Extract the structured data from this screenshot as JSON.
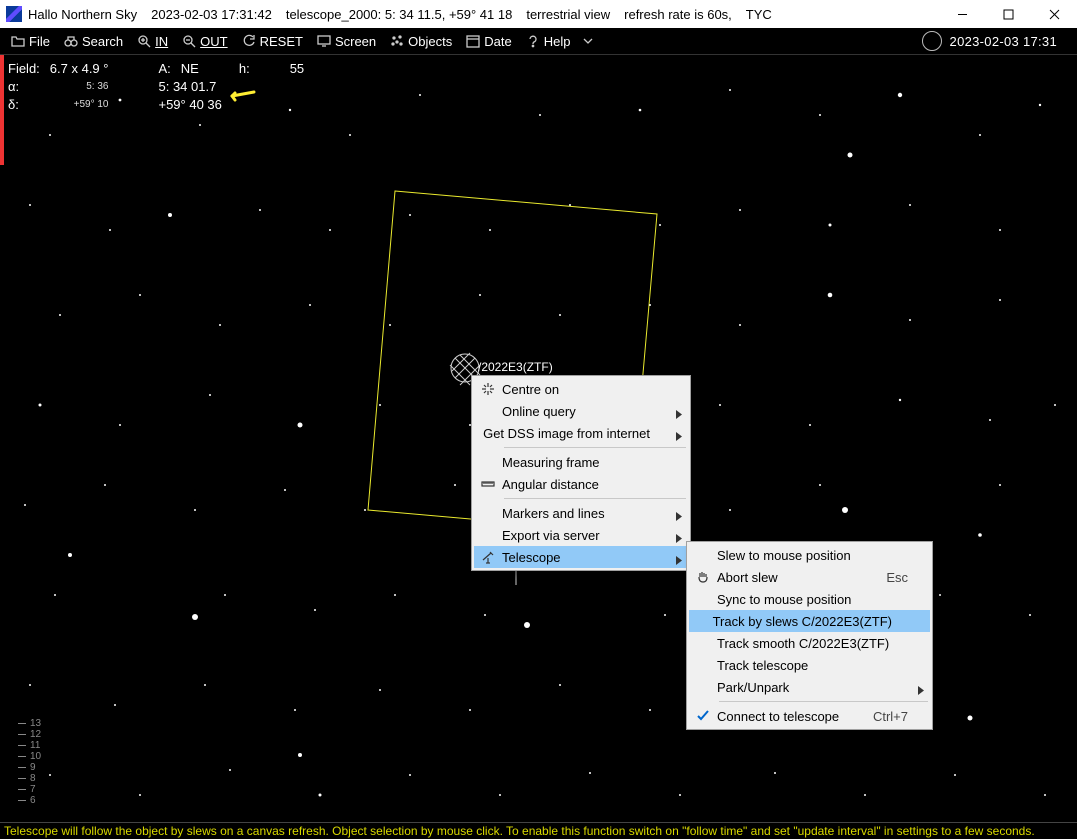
{
  "titlebar": {
    "app": "Hallo Northern Sky",
    "datetime": "2023-02-03  17:31:42",
    "telescope": "telescope_2000:  5: 34 11.5, +59° 41 18",
    "view": "terrestrial view",
    "refresh": "refresh rate is 60s,",
    "catalog": "TYC"
  },
  "menubar": {
    "file": "File",
    "search": "Search",
    "in": "IN",
    "out": "OUT",
    "reset": "RESET",
    "screen": "Screen",
    "objects": "Objects",
    "date": "Date",
    "help": "Help",
    "datetime": "2023-02-03  17:31"
  },
  "hud": {
    "field_label": "Field:",
    "field_value": "6.7  x  4.9 °",
    "az_label": "A:",
    "az_value": "NE",
    "alt_label": "h:",
    "alt_value": "55",
    "alpha_label": "α:",
    "alpha_small": "5: 36",
    "alpha_value": "5: 34 01.7",
    "delta_label": "δ:",
    "delta_small": "+59° 10",
    "delta_value": "+59° 40 36"
  },
  "object": {
    "label": "/2022E3(ZTF)"
  },
  "scale": [
    "13",
    "12",
    "11",
    "10",
    "9",
    "8",
    "7",
    "6"
  ],
  "context_main": {
    "centre": "Centre on",
    "online": "Online query",
    "dss": "Get DSS image from internet",
    "measuring": "Measuring frame",
    "angular": "Angular distance",
    "markers": "Markers and lines",
    "export": "Export via server",
    "telescope": "Telescope"
  },
  "context_sub": {
    "slew": "Slew to mouse position",
    "abort": "Abort slew",
    "abort_accel": "Esc",
    "sync": "Sync to mouse position",
    "track_slews": "Track by slews C/2022E3(ZTF)",
    "track_smooth": "Track smooth C/2022E3(ZTF)",
    "track_tel": "Track telescope",
    "park": "Park/Unpark",
    "connect": "Connect to telescope",
    "connect_accel": "Ctrl+7"
  },
  "status": "Telescope will follow the object by slews on a canvas refresh. Object selection by mouse click. To enable this function switch on \"follow time\" and set \"update interval\" in settings to a few seconds."
}
